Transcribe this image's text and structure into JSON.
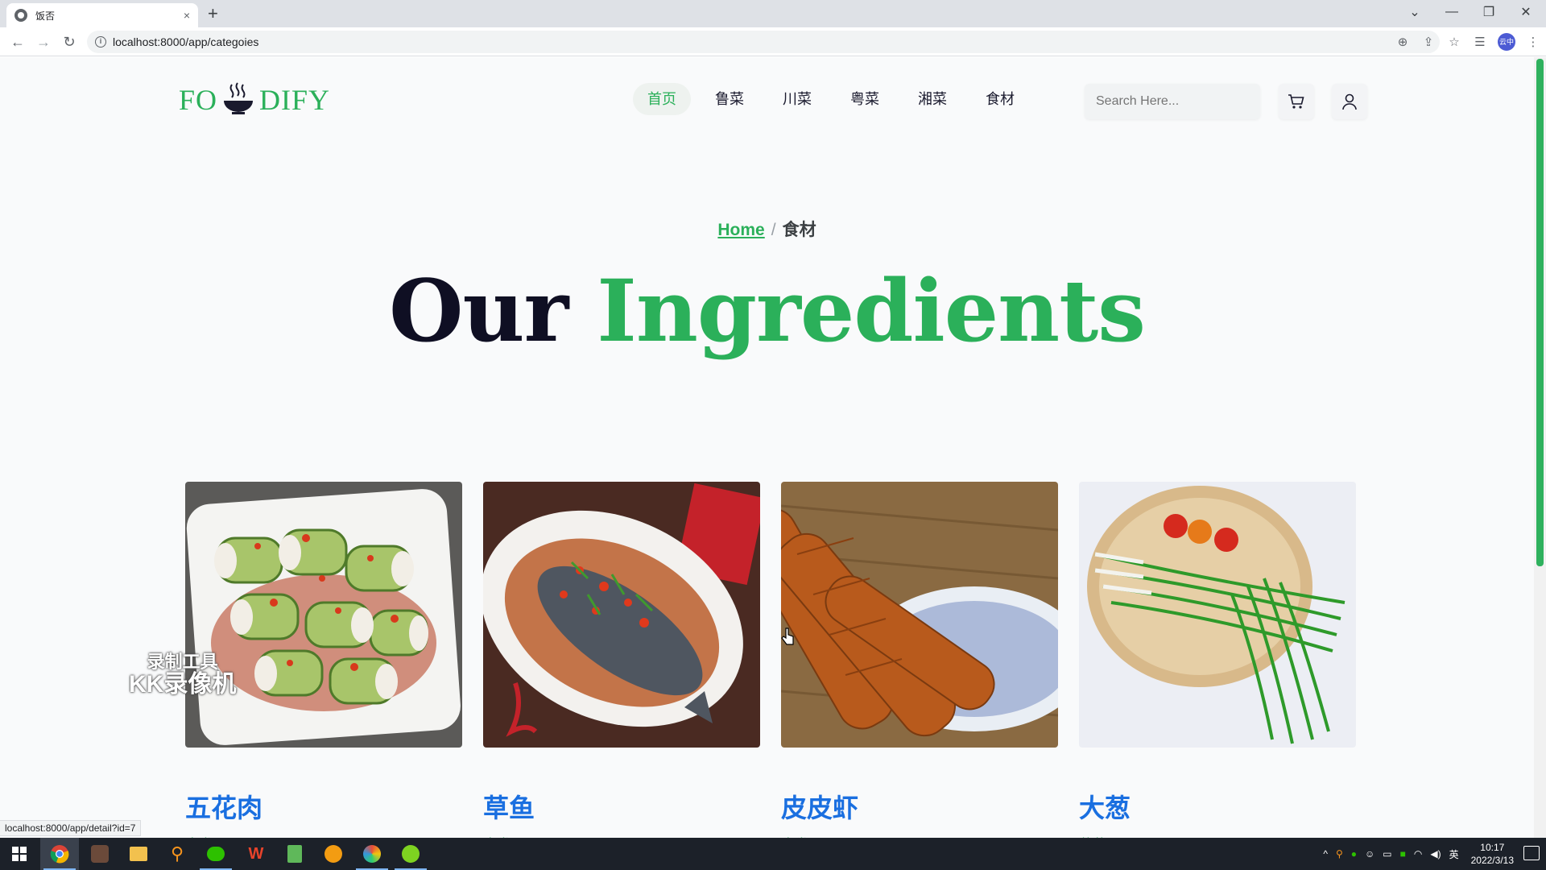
{
  "browser": {
    "tab_title": "饭否",
    "tab_close": "×",
    "new_tab": "+",
    "url": "localhost:8000/app/categoies",
    "profile_label": "云中",
    "status_url": "localhost:8000/app/detail?id=7",
    "window_controls": [
      "⌄",
      "—",
      "❐",
      "✕"
    ]
  },
  "site": {
    "logo_left": "FO",
    "logo_right": "DIFY",
    "nav": [
      {
        "label": "首页",
        "active": true
      },
      {
        "label": "鲁菜",
        "active": false
      },
      {
        "label": "川菜",
        "active": false
      },
      {
        "label": "粤菜",
        "active": false
      },
      {
        "label": "湘菜",
        "active": false
      },
      {
        "label": "食材",
        "active": false
      }
    ],
    "search_placeholder": "Search Here...",
    "accent_color": "#2bb05a",
    "title_color": "#1a6fe0"
  },
  "breadcrumb": {
    "home": "Home",
    "separator": "/",
    "current": "食材"
  },
  "hero": {
    "word1": "Our",
    "word2": "Ingredients"
  },
  "ingredients": [
    {
      "name": "五花肉",
      "category": "肉类"
    },
    {
      "name": "草鱼",
      "category": "肉类"
    },
    {
      "name": "皮皮虾",
      "category": "肉类"
    },
    {
      "name": "大葱",
      "category": "蔬菜"
    }
  ],
  "watermark": {
    "line1": "录制工具",
    "line2": "KK录像机"
  },
  "taskbar": {
    "time": "10:17",
    "date": "2022/3/13",
    "ime": "英"
  }
}
